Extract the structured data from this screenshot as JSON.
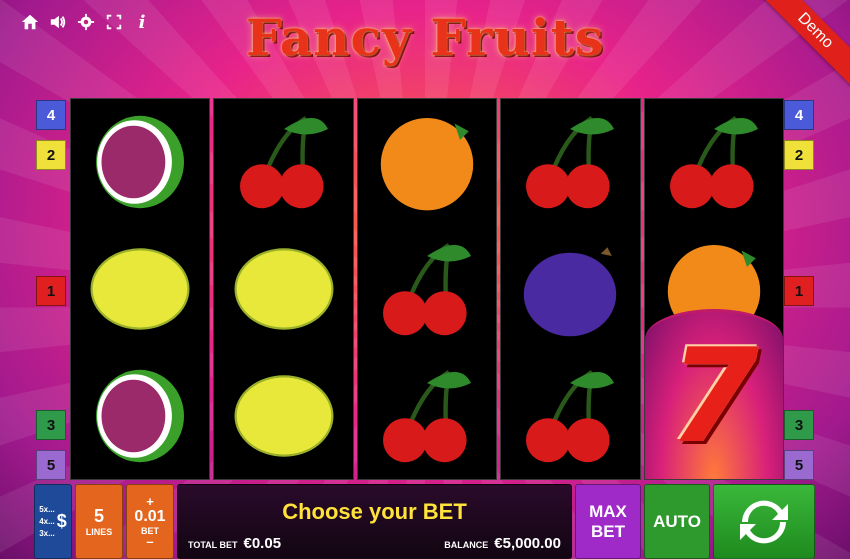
{
  "game": {
    "title": "Fancy Fruits",
    "demo_label": "Demo"
  },
  "toolbar": {
    "icons": [
      "home-icon",
      "sound-icon",
      "settings-icon",
      "fullscreen-icon",
      "info-icon"
    ]
  },
  "reels": [
    [
      "watermelon",
      "lemon",
      "watermelon"
    ],
    [
      "cherry",
      "lemon",
      "lemon"
    ],
    [
      "orange",
      "cherry",
      "cherry"
    ],
    [
      "cherry",
      "plum",
      "cherry"
    ],
    [
      "cherry",
      "orange",
      "seven"
    ]
  ],
  "line_markers": {
    "left": [
      {
        "label": "4",
        "color": "#4a5ad8"
      },
      {
        "label": "2",
        "color": "#f0e03a"
      },
      {
        "label": "1",
        "color": "#e02020"
      },
      {
        "label": "3",
        "color": "#2e9a4a"
      },
      {
        "label": "5",
        "color": "#9a6ad0"
      }
    ],
    "right": [
      {
        "label": "4",
        "color": "#4a5ad8"
      },
      {
        "label": "2",
        "color": "#f0e03a"
      },
      {
        "label": "1",
        "color": "#e02020"
      },
      {
        "label": "3",
        "color": "#2e9a4a"
      },
      {
        "label": "5",
        "color": "#9a6ad0"
      }
    ]
  },
  "controls": {
    "paytable": {
      "lines": [
        "5x...",
        "4x...",
        "3x..."
      ],
      "symbol": "$"
    },
    "lines": {
      "value": "5",
      "label": "LINES"
    },
    "bet": {
      "plus": "+",
      "value": "0.01",
      "label": "BET",
      "minus": "–"
    },
    "message": "Choose your BET",
    "total_bet": {
      "label": "TOTAL BET",
      "value": "€0.05"
    },
    "balance": {
      "label": "BALANCE",
      "value": "€5,000.00"
    },
    "max_bet": {
      "line1": "MAX",
      "line2": "BET"
    },
    "auto": "AUTO"
  }
}
